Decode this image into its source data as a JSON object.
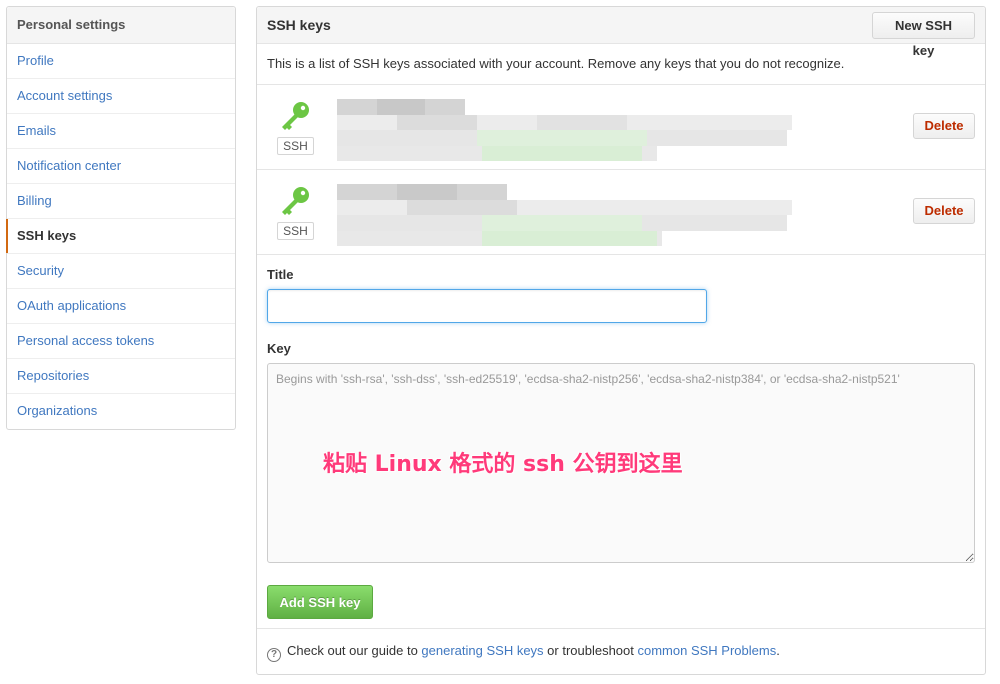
{
  "sidebar": {
    "title": "Personal settings",
    "items": [
      {
        "label": "Profile"
      },
      {
        "label": "Account settings"
      },
      {
        "label": "Emails"
      },
      {
        "label": "Notification center"
      },
      {
        "label": "Billing"
      },
      {
        "label": "SSH keys",
        "selected": true
      },
      {
        "label": "Security"
      },
      {
        "label": "OAuth applications"
      },
      {
        "label": "Personal access tokens"
      },
      {
        "label": "Repositories"
      },
      {
        "label": "Organizations"
      }
    ]
  },
  "main": {
    "title": "SSH keys",
    "new_button": "New SSH key",
    "description": "This is a list of SSH keys associated with your account. Remove any keys that you do not recognize.",
    "keys": [
      {
        "badge": "SSH",
        "delete_label": "Delete"
      },
      {
        "badge": "SSH",
        "delete_label": "Delete"
      }
    ],
    "form": {
      "title_label": "Title",
      "title_value": "",
      "key_label": "Key",
      "key_placeholder": "Begins with 'ssh-rsa', 'ssh-dss', 'ssh-ed25519', 'ecdsa-sha2-nistp256', 'ecdsa-sha2-nistp384', or 'ecdsa-sha2-nistp521'",
      "add_button": "Add SSH key"
    },
    "annotation": "粘贴 Linux 格式的 ssh 公钥到这里",
    "footer": {
      "text_before": "Check out our guide to ",
      "link1": "generating SSH keys",
      "text_middle": " or troubleshoot ",
      "link2": "common SSH Problems",
      "text_after": "."
    }
  },
  "colors": {
    "link": "#4078c0",
    "selected_marker": "#d26911",
    "key_icon": "#6cc644",
    "delete_text": "#bd2c00",
    "add_button": "#60b044",
    "annotation": "#ff3a7a"
  }
}
